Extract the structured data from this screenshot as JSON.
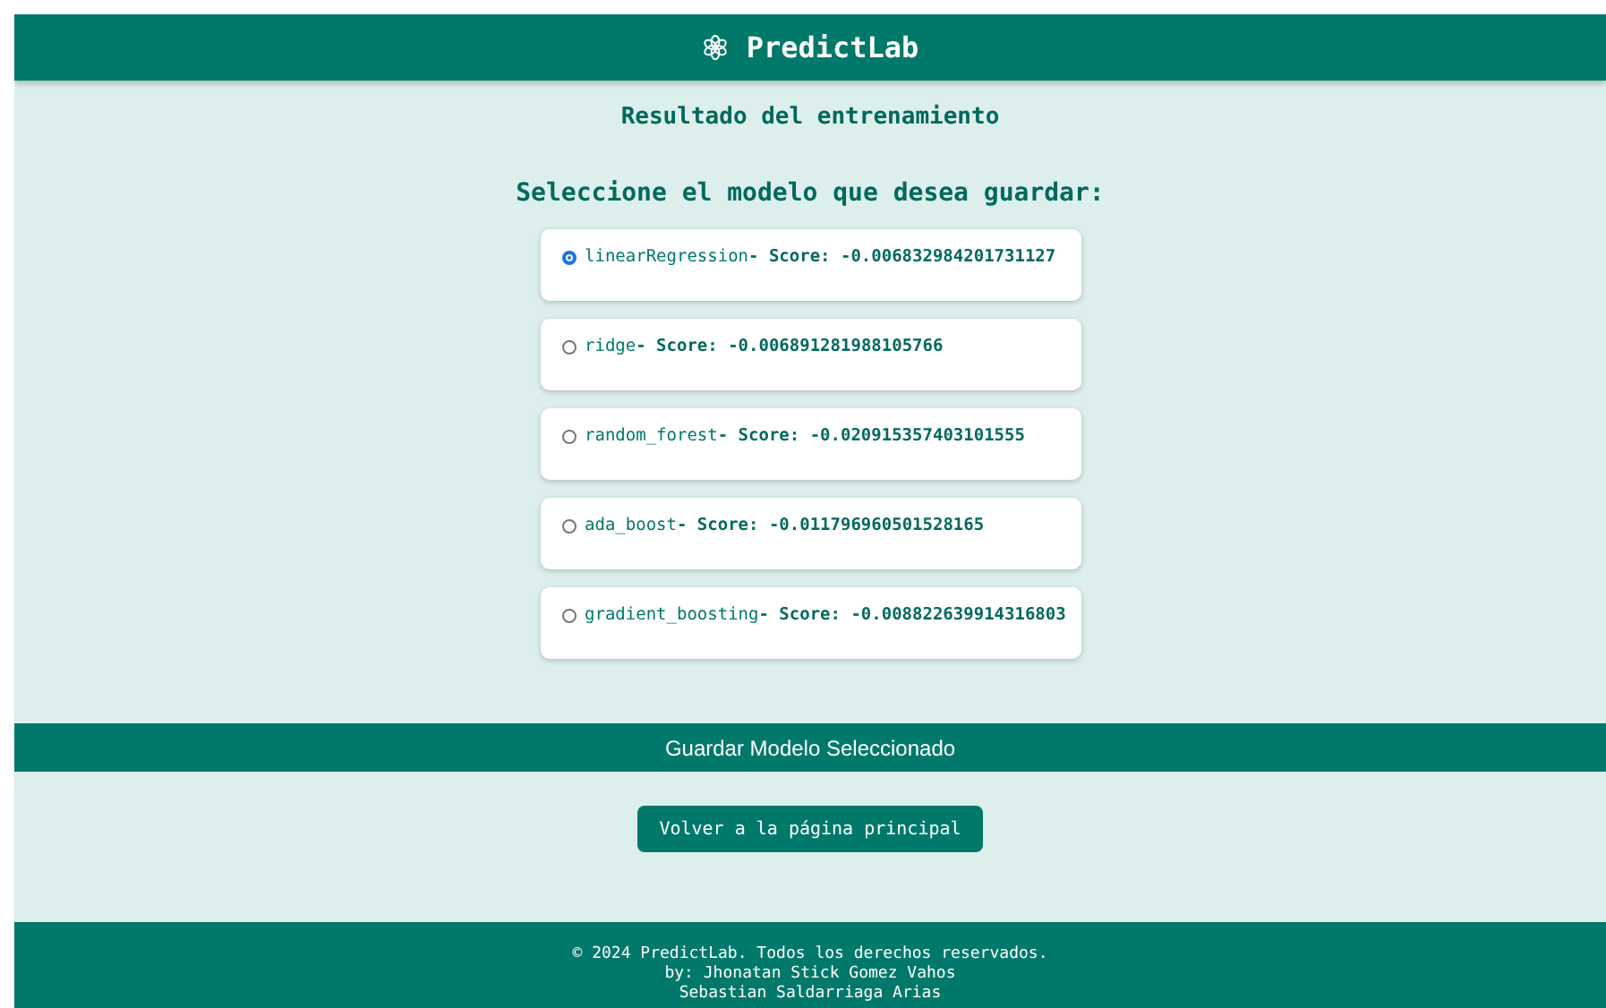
{
  "header": {
    "title": "PredictLab"
  },
  "heading": "Resultado del entrenamiento",
  "prompt": "Seleccione el modelo que desea guardar:",
  "models": [
    {
      "name": "linearRegression",
      "score_label": "- Score: -0.006832984201731127",
      "selected": true
    },
    {
      "name": "ridge",
      "score_label": "- Score: -0.006891281988105766",
      "selected": false
    },
    {
      "name": "random_forest",
      "score_label": "- Score: -0.020915357403101555",
      "selected": false
    },
    {
      "name": "ada_boost",
      "score_label": "- Score: -0.011796960501528165",
      "selected": false
    },
    {
      "name": "gradient_boosting",
      "score_label": "- Score: -0.008822639914316803",
      "selected": false
    }
  ],
  "save_button": "Guardar Modelo Seleccionado",
  "back_button": "Volver a la página principal",
  "footer": [
    "© 2024 PredictLab. Todos los derechos reservados.",
    "by: Jhonatan Stick Gomez Vahos",
    "Sebastian Saldarriaga Arias"
  ]
}
